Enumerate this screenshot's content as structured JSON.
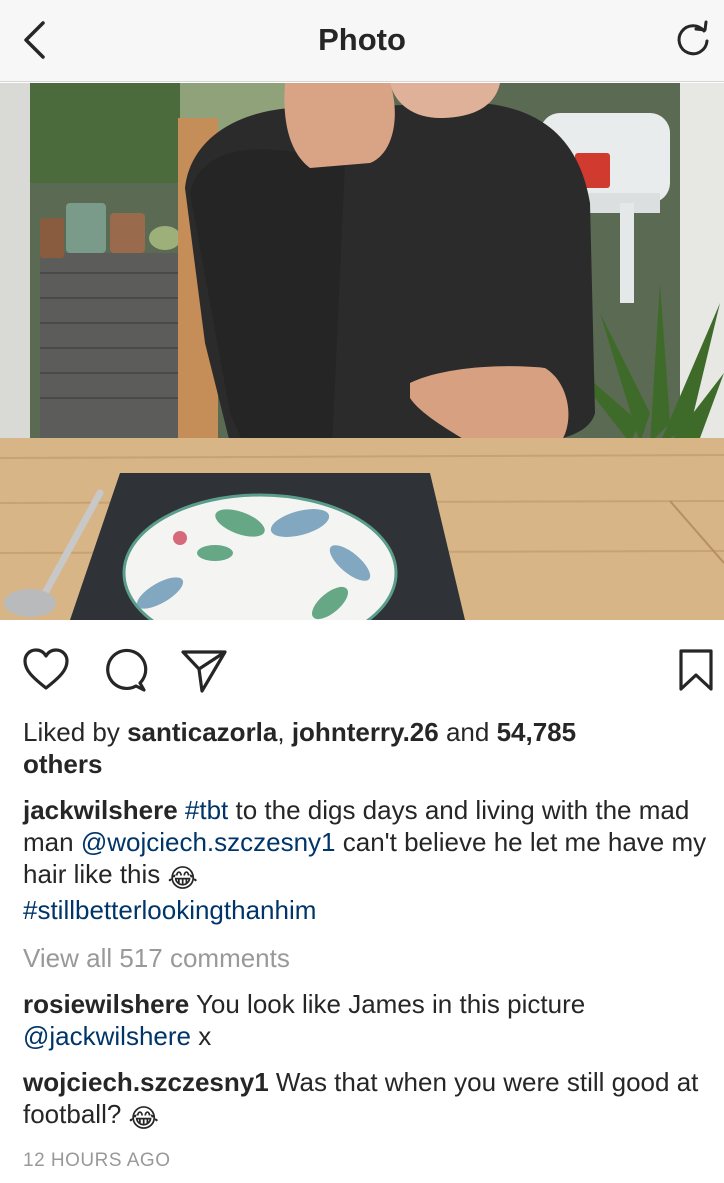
{
  "header": {
    "title": "Photo"
  },
  "post": {
    "likes": {
      "prefix": "Liked by ",
      "user1": "santicazorla",
      "separator": ", ",
      "user2": "johnterry.26",
      "and": " and ",
      "count": "54,785",
      "suffix": "others"
    },
    "caption": {
      "author": "jackwilshere",
      "hashtag1": "#tbt",
      "text1": " to the digs days and living with the mad man ",
      "mention": "@wojciech.szczesny1",
      "text2": " can't believe he let me have my hair like this",
      "emoji": "😂",
      "hashtag2": "#stillbetterlookingthanhim"
    },
    "view_all_comments": "View all 517 comments",
    "comments": [
      {
        "author": "rosiewilshere",
        "text": " You look like James in this picture ",
        "mention": "@jackwilshere",
        "after": " x"
      },
      {
        "author": "wojciech.szczesny1",
        "text": " Was that when you were still good at football?",
        "emoji": "😂"
      }
    ],
    "timestamp": "12 HOURS AGO"
  },
  "icons": {
    "back": "chevron-left-icon",
    "refresh": "refresh-icon",
    "like": "heart-icon",
    "comment": "comment-bubble-icon",
    "share": "paper-plane-icon",
    "save": "bookmark-icon"
  }
}
